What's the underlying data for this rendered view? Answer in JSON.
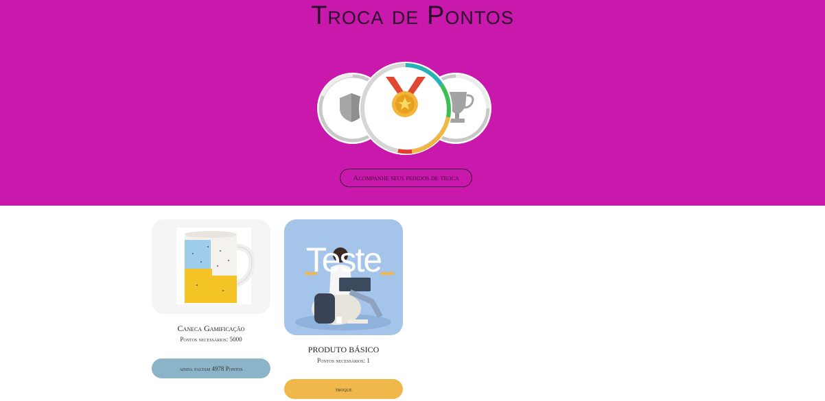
{
  "header": {
    "title": "Troca de Pontos",
    "orders_button_label": "Acompanhe seus pedidos de troca",
    "background_color": "#c918ac",
    "medals": [
      {
        "name": "shield-icon",
        "state": "inactive"
      },
      {
        "name": "medal-icon",
        "state": "active"
      },
      {
        "name": "trophy-icon",
        "state": "inactive"
      }
    ]
  },
  "products": [
    {
      "name": "Caneca Gamificação",
      "points_required": "Pontos necessários: 5000",
      "button_label": "ainda faltam 4978 Pontos",
      "button_color": "#8bb4c8",
      "image": "mug-image"
    },
    {
      "name": "PRODUTO BÁSICO",
      "points_required": "Pontos necessários: 1",
      "button_label": "troque",
      "button_color": "#f0b84a",
      "image": "teste-photo",
      "image_text": "Teste"
    }
  ]
}
